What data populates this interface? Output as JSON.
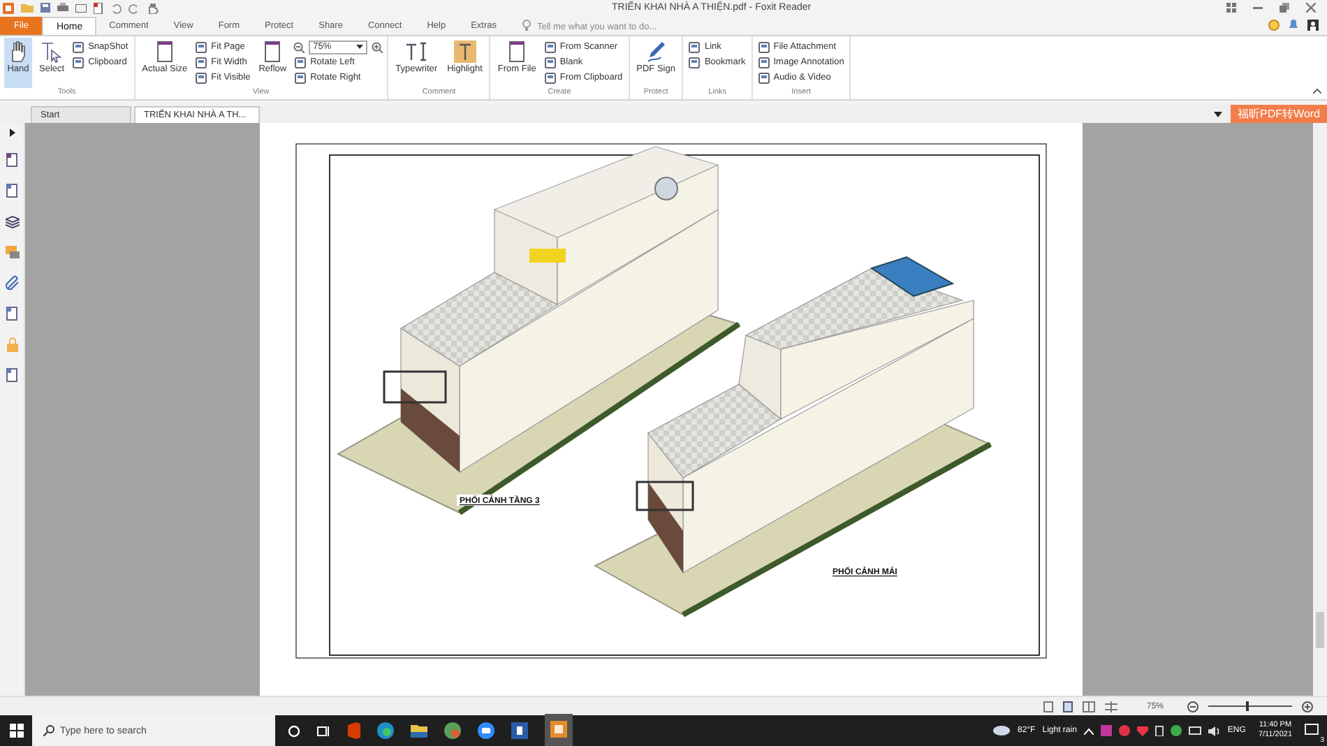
{
  "window": {
    "title": "TRIỂN KHAI NHÀ A THIỆN.pdf - Foxit Reader"
  },
  "menu_tabs": [
    {
      "label": "File",
      "kind": "file",
      "selected": false
    },
    {
      "label": "Home",
      "kind": "tab",
      "selected": true
    },
    {
      "label": "Comment",
      "kind": "tab",
      "selected": false
    },
    {
      "label": "View",
      "kind": "tab",
      "selected": false
    },
    {
      "label": "Form",
      "kind": "tab",
      "selected": false
    },
    {
      "label": "Protect",
      "kind": "tab",
      "selected": false
    },
    {
      "label": "Share",
      "kind": "tab",
      "selected": false
    },
    {
      "label": "Connect",
      "kind": "tab",
      "selected": false
    },
    {
      "label": "Help",
      "kind": "tab",
      "selected": false
    },
    {
      "label": "Extras",
      "kind": "tab",
      "selected": false
    }
  ],
  "search": {
    "placeholder": "Tell me what you want to do..."
  },
  "ribbon": {
    "groups": [
      {
        "label": "Tools",
        "items": [
          {
            "label": "Hand",
            "kind": "large",
            "selected": true
          },
          {
            "label": "Select",
            "kind": "large",
            "selected": false
          },
          {
            "label": "SnapShot",
            "kind": "small",
            "selected": false
          },
          {
            "label": "Clipboard",
            "kind": "small",
            "selected": false
          }
        ]
      },
      {
        "label": "View",
        "items": [
          {
            "label": "Actual Size",
            "kind": "large",
            "selected": false
          },
          {
            "label": "Fit Page",
            "kind": "small",
            "selected": false
          },
          {
            "label": "Fit Width",
            "kind": "small",
            "selected": false
          },
          {
            "label": "Fit Visible",
            "kind": "small",
            "selected": false
          },
          {
            "label": "Reflow",
            "kind": "large",
            "selected": false
          },
          {
            "value": "75%",
            "kind": "field"
          },
          {
            "label": "Rotate Left",
            "kind": "small",
            "selected": false
          },
          {
            "label": "Rotate Right",
            "kind": "small",
            "selected": false
          }
        ]
      },
      {
        "label": "Comment",
        "items": [
          {
            "label": "Typewriter",
            "kind": "large",
            "selected": false
          },
          {
            "label": "Highlight",
            "kind": "large",
            "selected": false
          }
        ]
      },
      {
        "label": "Create",
        "items": [
          {
            "label": "From File",
            "kind": "large",
            "selected": false
          },
          {
            "label": "From Scanner",
            "kind": "small",
            "selected": false
          },
          {
            "label": "Blank",
            "kind": "small",
            "selected": false
          },
          {
            "label": "From Clipboard",
            "kind": "small",
            "selected": false
          }
        ]
      },
      {
        "label": "Protect",
        "items": [
          {
            "label": "PDF Sign",
            "kind": "large",
            "selected": false
          }
        ]
      },
      {
        "label": "Links",
        "items": [
          {
            "label": "Link",
            "kind": "small",
            "selected": false
          },
          {
            "label": "Bookmark",
            "kind": "small",
            "selected": false
          }
        ]
      },
      {
        "label": "Insert",
        "items": [
          {
            "label": "File Attachment",
            "kind": "small",
            "selected": false
          },
          {
            "label": "Image Annotation",
            "kind": "small",
            "selected": false
          },
          {
            "label": "Audio & Video",
            "kind": "small",
            "selected": false
          }
        ]
      }
    ]
  },
  "doc_tabs": [
    {
      "label": "Start",
      "selected": false
    },
    {
      "label": "TRIỂN KHAI NHÀ A TH...",
      "selected": true
    }
  ],
  "convert_button": "福昕PDF转Word",
  "page": {
    "captions": [
      "PHỐI CẢNH TẦNG 3",
      "PHỐI CẢNH MÁI"
    ]
  },
  "status_bar": {
    "zoom": "75%",
    "zoom_slider": {
      "level": 0.45
    }
  },
  "taskbar": {
    "search": {
      "placeholder": "Type here to search"
    },
    "weather": {
      "temperature": "82°F",
      "condition": "Light rain"
    },
    "language": "ENG",
    "time": "11:40 PM",
    "date": "7/11/2021",
    "notifications": "3"
  }
}
